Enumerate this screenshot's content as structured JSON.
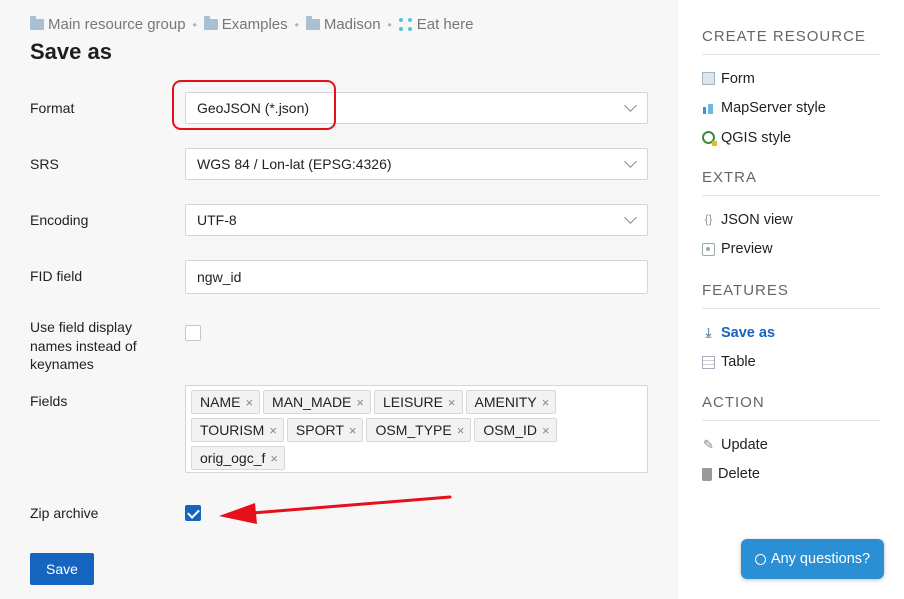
{
  "breadcrumb": [
    {
      "label": "Main resource group",
      "icon": "folder-icon"
    },
    {
      "label": "Examples",
      "icon": "folder-icon"
    },
    {
      "label": "Madison",
      "icon": "folder-icon"
    },
    {
      "label": "Eat here",
      "icon": "vector-layer-icon"
    }
  ],
  "breadcrumb_separator": "•",
  "page_title": "Save as",
  "form": {
    "format": {
      "label": "Format",
      "value": "GeoJSON (*.json)"
    },
    "srs": {
      "label": "SRS",
      "value": "WGS 84 / Lon-lat (EPSG:4326)"
    },
    "encoding": {
      "label": "Encoding",
      "value": "UTF-8"
    },
    "fid_field": {
      "label": "FID field",
      "value": "ngw_id"
    },
    "display_names": {
      "label": "Use field display names instead of keynames",
      "checked": false
    },
    "fields": {
      "label": "Fields",
      "tags": [
        "NAME",
        "MAN_MADE",
        "LEISURE",
        "AMENITY",
        "TOURISM",
        "SPORT",
        "OSM_TYPE",
        "OSM_ID",
        "orig_ogc_f"
      ],
      "remove_glyph": "×"
    },
    "zip_archive": {
      "label": "Zip archive",
      "checked": true
    },
    "save_label": "Save"
  },
  "sidebar": {
    "create_resource": {
      "header": "CREATE RESOURCE",
      "items": [
        {
          "label": "Form",
          "icon": "form-icon"
        },
        {
          "label": "MapServer style",
          "icon": "mapserver-style-icon"
        },
        {
          "label": "QGIS style",
          "icon": "qgis-style-icon"
        }
      ]
    },
    "extra": {
      "header": "EXTRA",
      "items": [
        {
          "label": "JSON view",
          "icon": "json-icon"
        },
        {
          "label": "Preview",
          "icon": "preview-icon"
        }
      ]
    },
    "features": {
      "header": "FEATURES",
      "items": [
        {
          "label": "Save as",
          "icon": "download-icon",
          "active": true
        },
        {
          "label": "Table",
          "icon": "table-icon"
        }
      ]
    },
    "action": {
      "header": "ACTION",
      "items": [
        {
          "label": "Update",
          "icon": "pencil-icon"
        },
        {
          "label": "Delete",
          "icon": "trash-icon"
        }
      ]
    }
  },
  "chat_button": "Any questions?",
  "colors": {
    "primary": "#1565c0",
    "annotation": "#e5101c",
    "chat": "#2b8fd6"
  }
}
